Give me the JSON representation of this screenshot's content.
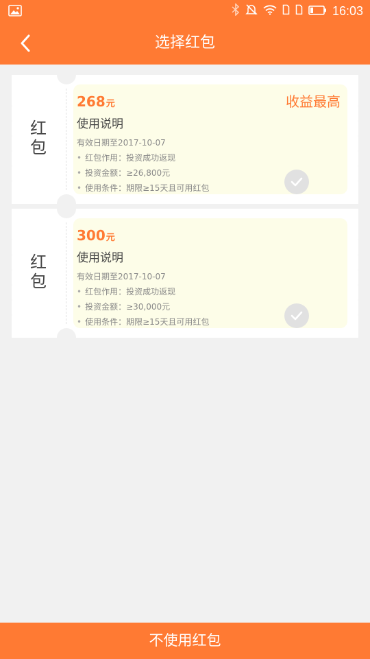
{
  "status_bar": {
    "time": "16:03",
    "icons": [
      "image-icon",
      "bluetooth-icon",
      "mute-icon",
      "wifi-icon",
      "sim-icon",
      "sim-icon",
      "battery-icon"
    ]
  },
  "header": {
    "title": "选择红包",
    "back_icon": "chevron-left-icon"
  },
  "coupons": [
    {
      "side_label": [
        "红",
        "包"
      ],
      "amount": "268",
      "unit": "元",
      "badge": "收益最高",
      "usage_title": "使用说明",
      "expire": "有效日期至2017-10-07",
      "rules": [
        "红包作用：投资成功返现",
        "投资金额：≥26,800元",
        "使用条件：期限≥15天且可用红包"
      ],
      "check_icon": "check-icon"
    },
    {
      "side_label": [
        "红",
        "包"
      ],
      "amount": "300",
      "unit": "元",
      "badge": "",
      "usage_title": "使用说明",
      "expire": "有效日期至2017-10-07",
      "rules": [
        "红包作用：投资成功返现",
        "投资金额：≥30,000元",
        "使用条件：期限≥15天且可用红包"
      ],
      "check_icon": "check-icon"
    }
  ],
  "footer": {
    "button_label": "不使用红包"
  },
  "colors": {
    "accent": "#ff7a33",
    "background": "#f1f1f1",
    "panel": "#fdfde8"
  }
}
